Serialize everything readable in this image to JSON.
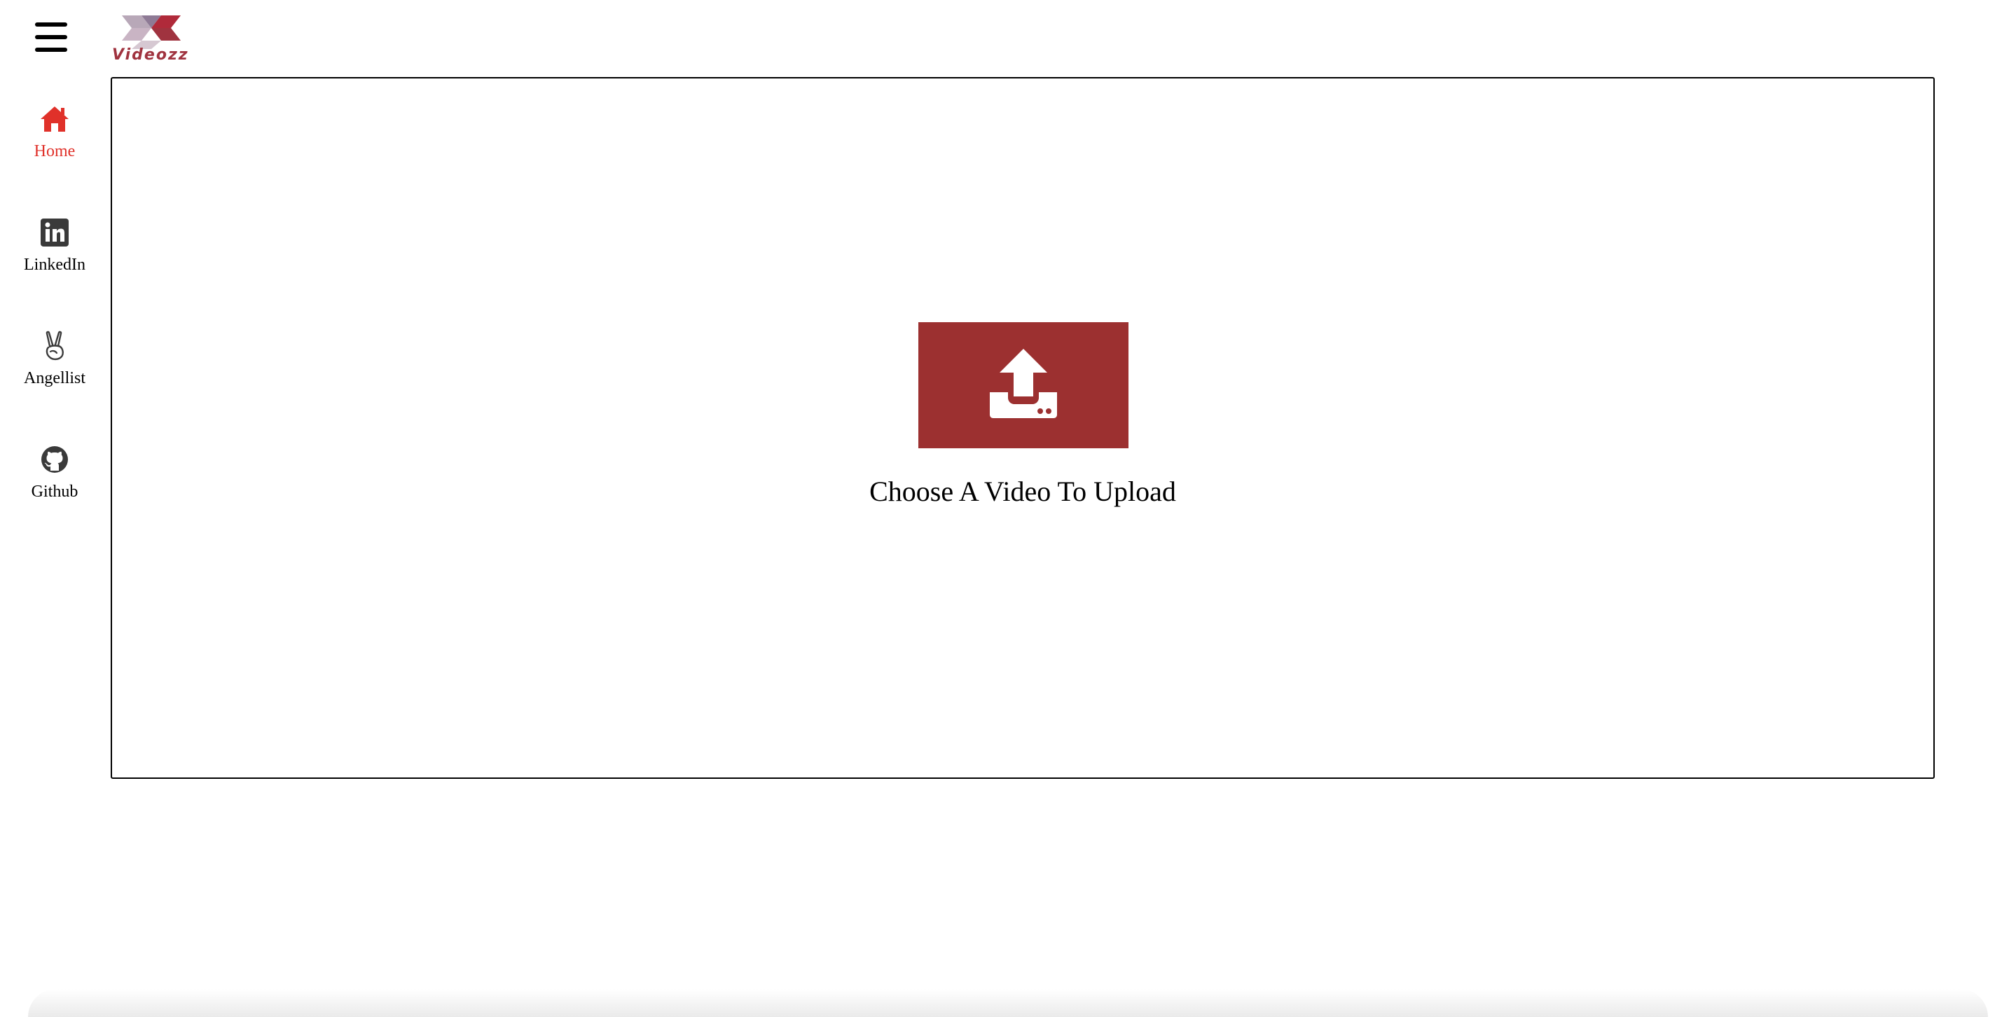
{
  "header": {
    "menu_icon": "hamburger-menu-icon",
    "logo_text": "Videozz"
  },
  "sidebar": {
    "items": [
      {
        "label": "Home",
        "icon": "home-icon",
        "active": true
      },
      {
        "label": "LinkedIn",
        "icon": "linkedin-icon",
        "active": false
      },
      {
        "label": "Angellist",
        "icon": "angellist-icon",
        "active": false
      },
      {
        "label": "Github",
        "icon": "github-icon",
        "active": false
      }
    ]
  },
  "main": {
    "upload_icon": "upload-icon",
    "upload_caption": "Choose A Video To Upload"
  },
  "colors": {
    "accent_red": "#e0312a",
    "upload_button": "#9c3030",
    "logo": "#a0333f"
  }
}
